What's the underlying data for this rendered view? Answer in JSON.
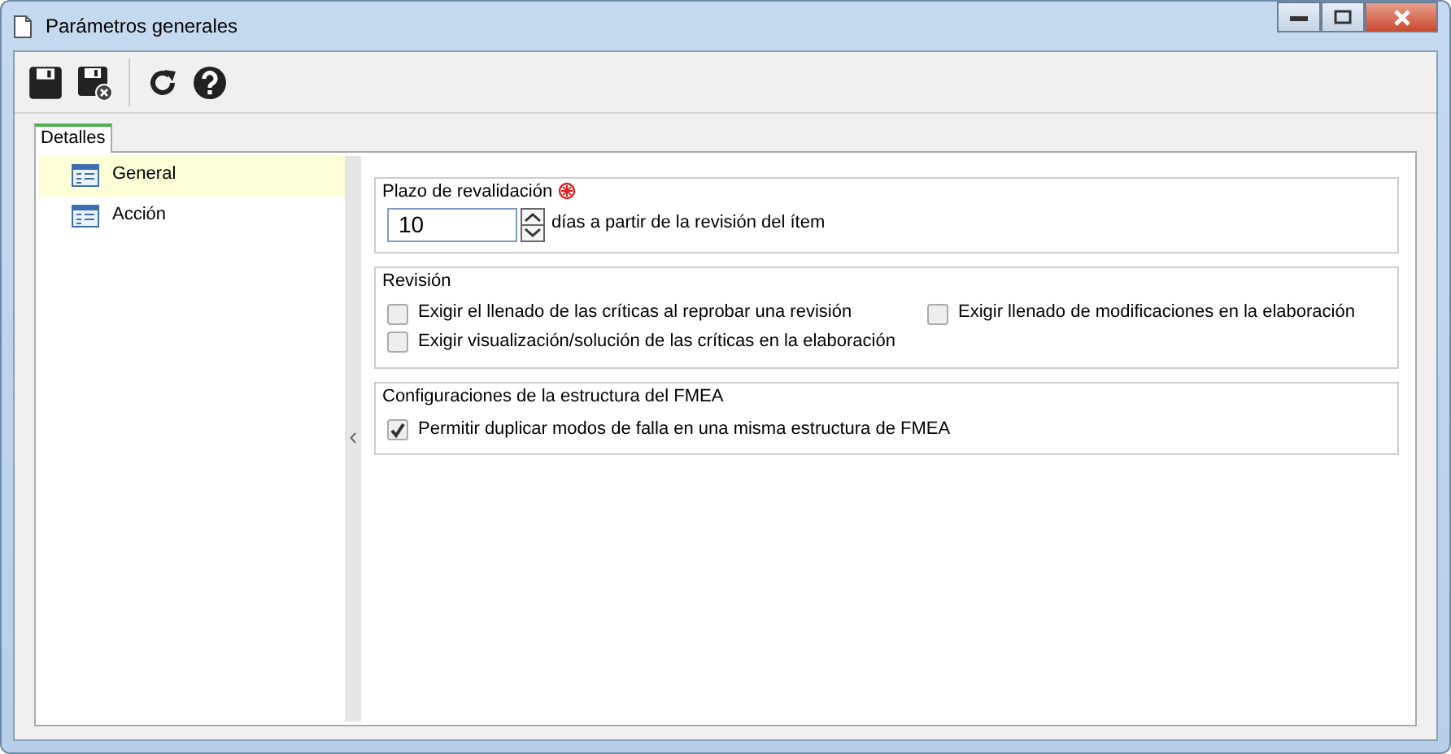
{
  "window": {
    "title": "Parámetros generales"
  },
  "tabs": [
    {
      "label": "Detalles",
      "selected": true
    }
  ],
  "sidebar": {
    "items": [
      {
        "label": "General",
        "selected": true
      },
      {
        "label": "Acción",
        "selected": false
      }
    ]
  },
  "sections": [
    {
      "legend": "Plazo de revalidación",
      "required": true,
      "kind": "number",
      "value": "10",
      "suffix": "días a partir de la revisión del ítem"
    },
    {
      "legend": "Revisión",
      "kind": "checks",
      "items": [
        {
          "label": "Exigir el llenado de las críticas al reprobar una revisión",
          "checked": false
        },
        {
          "label": "Exigir llenado de modificaciones en la elaboración",
          "checked": false
        },
        {
          "label": "Exigir visualización/solución de las críticas en la elaboración",
          "checked": false
        }
      ]
    },
    {
      "legend": "Configuraciones de la estructura del FMEA",
      "kind": "checks",
      "items": [
        {
          "label": "Permitir duplicar modos de falla en una misma estructura de FMEA",
          "checked": true
        }
      ]
    }
  ]
}
